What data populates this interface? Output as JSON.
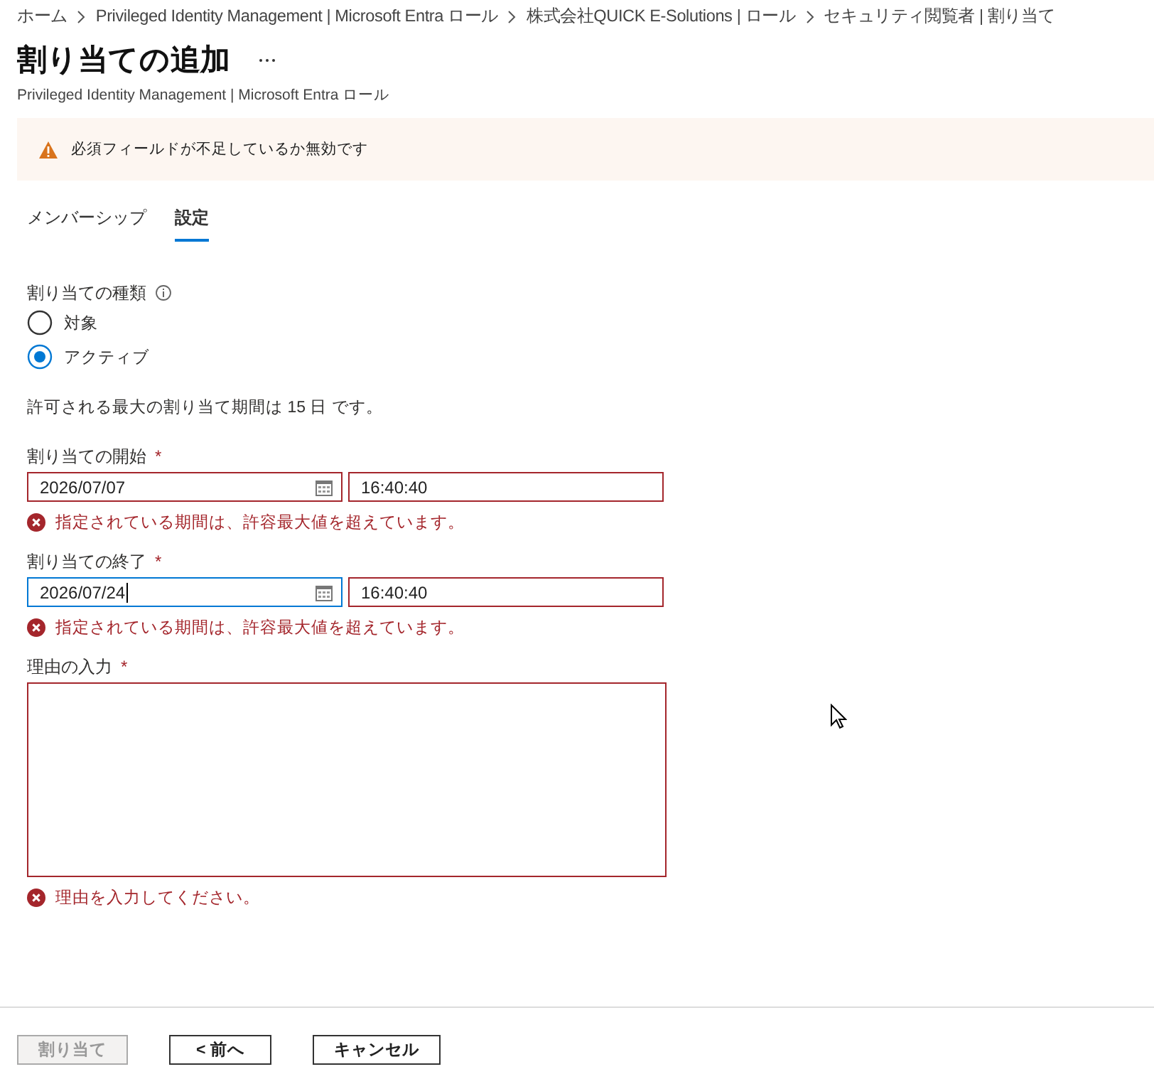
{
  "breadcrumb": [
    "ホーム",
    "Privileged Identity Management | Microsoft Entra ロール",
    "株式会社QUICK E-Solutions | ロール",
    "セキュリティ閲覧者 | 割り当て"
  ],
  "title": "割り当ての追加",
  "subtitle": "Privileged Identity Management | Microsoft Entra ロール",
  "alert": {
    "kind": "warning",
    "text": "必須フィールドが不足しているか無効です"
  },
  "tabs": [
    {
      "label": "メンバーシップ",
      "selected": false
    },
    {
      "label": "設定",
      "selected": true
    }
  ],
  "assignment_type": {
    "label": "割り当ての種類",
    "options": [
      {
        "label": "対象",
        "selected": false
      },
      {
        "label": "アクティブ",
        "selected": true
      }
    ]
  },
  "notice": "許可される最大の割り当て期間は 15 日 です。",
  "periods": [
    {
      "label": "割り当ての開始",
      "required_mark": "*",
      "date": "2026/07/07",
      "date_focused": false,
      "time": "16:40:40",
      "error": "指定されている期間は、許容最大値を超えています。"
    },
    {
      "label": "割り当ての終了",
      "required_mark": "*",
      "date": "2026/07/24",
      "date_focused": true,
      "time": "16:40:40",
      "error": "指定されている期間は、許容最大値を超えています。"
    }
  ],
  "reason": {
    "label": "理由の入力",
    "required_mark": "*",
    "error": "理由を入力してください。"
  },
  "buttons": [
    {
      "label": "割り当て",
      "disabled": true
    },
    {
      "label": "< 前へ",
      "disabled": false
    },
    {
      "label": "キャンセル",
      "disabled": false
    }
  ]
}
